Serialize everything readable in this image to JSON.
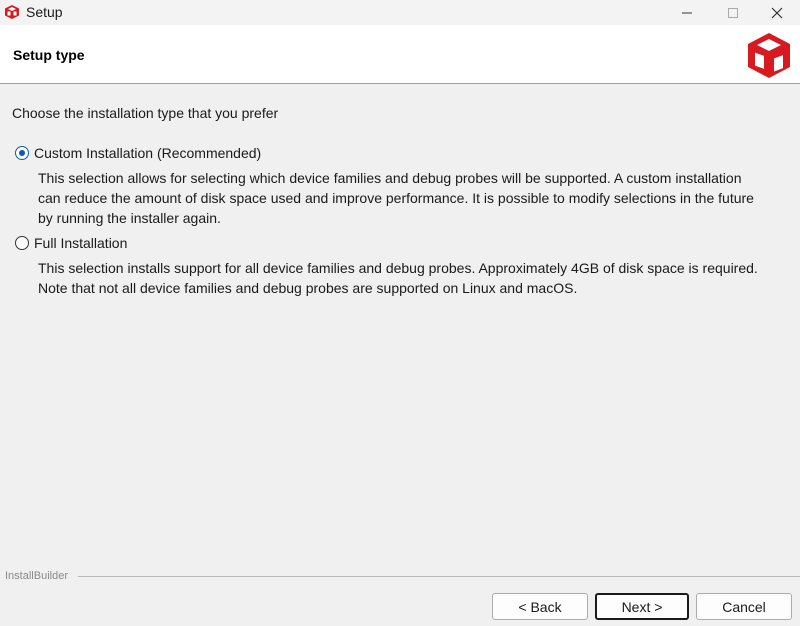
{
  "window": {
    "title": "Setup",
    "icon": "installbuilder-cube-icon",
    "controls": [
      "minimize-icon",
      "maximize-icon",
      "close-icon"
    ]
  },
  "header": {
    "title": "Setup type",
    "logo": "red-cube-logo"
  },
  "main": {
    "prompt": "Choose the installation type that you prefer",
    "options": [
      {
        "label": "Custom Installation (Recommended)",
        "selected": true,
        "description": "This selection allows for selecting which device families and debug probes will be supported.  A custom installation can reduce the amount of disk space used and improve performance.  It is possible to modify selections in the future by running the installer again."
      },
      {
        "label": "Full Installation",
        "selected": false,
        "description": "This selection installs support for all device families and debug probes.  Approximately 4GB of disk space is required.  Note that not all device families and debug probes are supported on Linux and macOS."
      }
    ]
  },
  "footer": {
    "brand": "InstallBuilder",
    "back_label": "< Back",
    "next_label": "Next >",
    "cancel_label": "Cancel"
  },
  "colors": {
    "accent": "#0a5ab5",
    "logo_red": "#d71920"
  }
}
